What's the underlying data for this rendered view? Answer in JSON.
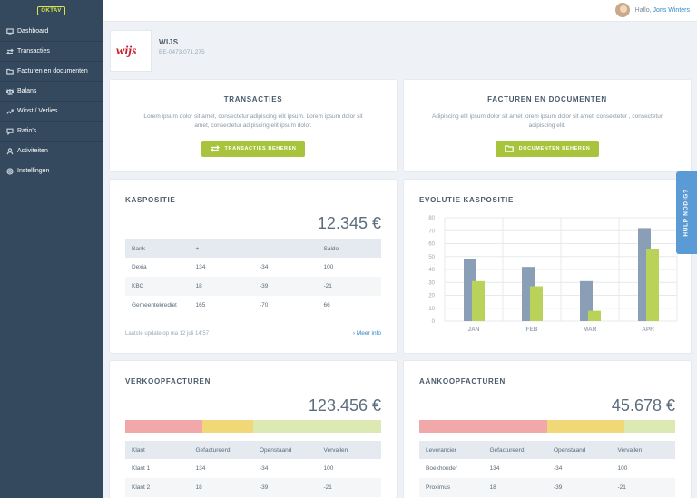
{
  "logo_text": "OKTAV",
  "nav": [
    {
      "label": "Dashboard",
      "icon": "monitor-icon"
    },
    {
      "label": "Transacties",
      "icon": "arrows-icon"
    },
    {
      "label": "Facturen en documenten",
      "icon": "folder-icon"
    },
    {
      "label": "Balans",
      "icon": "scale-icon"
    },
    {
      "label": "Winst / Verlies",
      "icon": "trend-icon"
    },
    {
      "label": "Ratio's",
      "icon": "chat-icon"
    },
    {
      "label": "Activiteiten",
      "icon": "person-icon"
    },
    {
      "label": "Instellingen",
      "icon": "gear-icon"
    }
  ],
  "user": {
    "greeting": "Hallo,",
    "name": "Joris Winters"
  },
  "company": {
    "name": "WIJS",
    "vat": "BE-0473.071.275",
    "logo_text": "wijs"
  },
  "transacties": {
    "title": "TRANSACTIES",
    "description": "Lorem ipsum dolor sit amet, consectetur adipiscing elit ipsum. Lorem ipsum dolor sit amet, consectetur adipiscing elit ipsum dolor.",
    "button": "TRANSACTIES BEHEREN"
  },
  "facturen": {
    "title": "FACTUREN EN DOCUMENTEN",
    "description": "Adipiscing elit ipsum dolor sit amet lorem ipsum dolor sit amet, consectetur , consectetur adipiscing elit.",
    "button": "DOCUMENTEN BEHEREN"
  },
  "kaspositie": {
    "title": "KASPOSITIE",
    "total": "12.345 €",
    "headers": [
      "Bank",
      "+",
      "-",
      "Saldo"
    ],
    "rows": [
      [
        "Dexia",
        "134",
        "-34",
        "100"
      ],
      [
        "KBC",
        "18",
        "-39",
        "-21"
      ],
      [
        "Gemeentekrediet",
        "165",
        "-70",
        "66"
      ]
    ],
    "footer": "Laatste update op ma 12 juli 14:57",
    "more": "Meer info"
  },
  "evolutie": {
    "title": "EVOLUTIE KASPOSITIE"
  },
  "chart_data": {
    "type": "bar",
    "categories": [
      "JAN",
      "FEB",
      "MAR",
      "APR"
    ],
    "series": [
      {
        "values": [
          48,
          42,
          31,
          72
        ],
        "color": "#8a9fb5"
      },
      {
        "values": [
          31,
          27,
          8,
          56
        ],
        "color": "#b8d25a"
      }
    ],
    "ylim": [
      0,
      80
    ],
    "yticks": [
      "0",
      "10",
      "20",
      "30",
      "40",
      "50",
      "60",
      "70",
      "80"
    ],
    "grid": true
  },
  "verkoop": {
    "title": "VERKOOPFACTUREN",
    "total": "123.456 €",
    "headers": [
      "Klant",
      "Gefactureerd",
      "Openstaand",
      "Vervallen"
    ],
    "rows": [
      [
        "Klant 1",
        "134",
        "-34",
        "100"
      ],
      [
        "Klant 2",
        "18",
        "-39",
        "-21"
      ]
    ],
    "segments": [
      {
        "share": 0.3,
        "color": "#f0a8a8"
      },
      {
        "share": 0.2,
        "color": "#f0d878"
      },
      {
        "share": 0.5,
        "color": "#dce9b2"
      }
    ]
  },
  "aankoop": {
    "title": "AANKOOPFACTUREN",
    "total": "45.678 €",
    "headers": [
      "Leverancier",
      "Gefactureerd",
      "Openstaand",
      "Vervallen"
    ],
    "rows": [
      [
        "Boekhouder",
        "134",
        "-34",
        "100"
      ],
      [
        "Proximus",
        "18",
        "-39",
        "-21"
      ]
    ],
    "segments": [
      {
        "share": 0.5,
        "color": "#f0a8a8"
      },
      {
        "share": 0.3,
        "color": "#f0d878"
      },
      {
        "share": 0.2,
        "color": "#dce9b2"
      }
    ]
  },
  "help": "HULP NODIG?"
}
